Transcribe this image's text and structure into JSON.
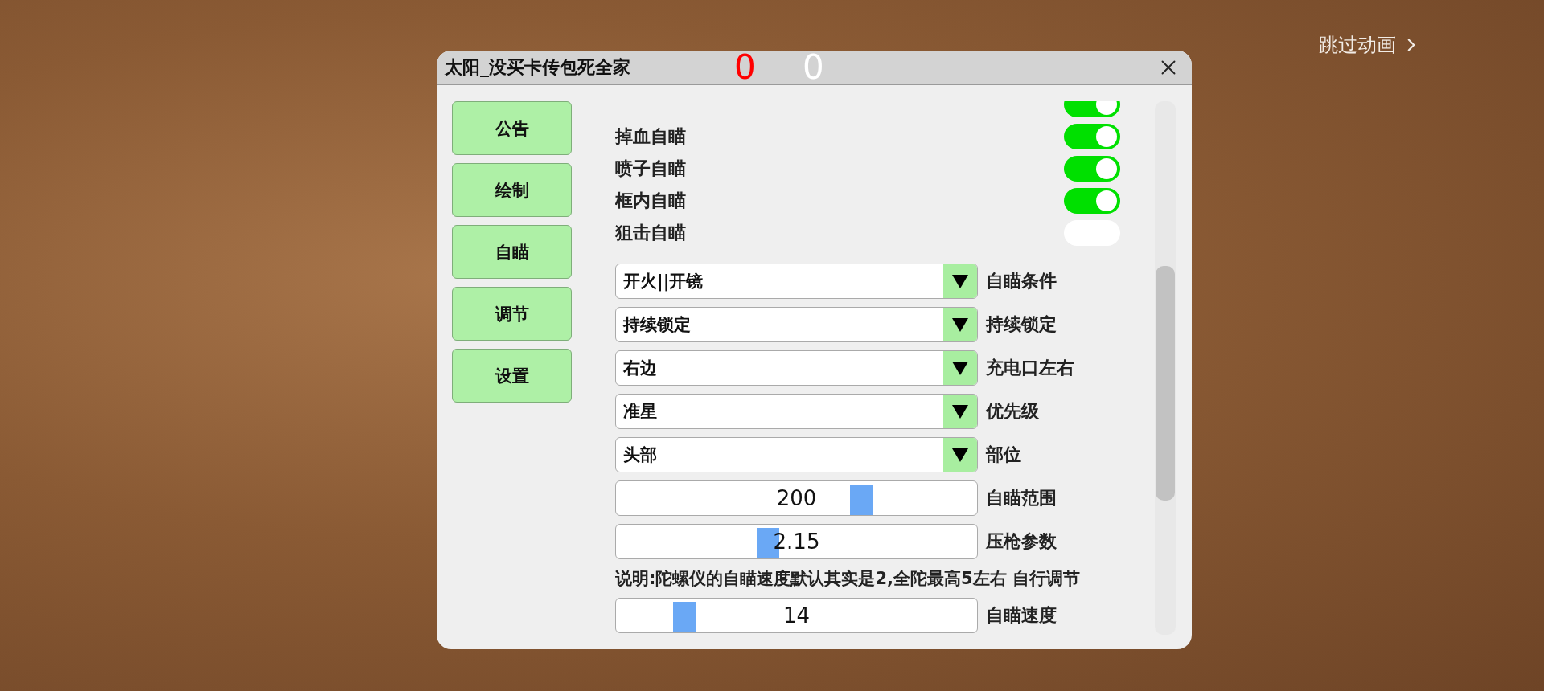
{
  "skip": {
    "label": "跳过动画"
  },
  "window": {
    "title": "太阳_没买卡传包死全家",
    "scores": [
      {
        "value": "0",
        "color": "#ff0000"
      },
      {
        "value": "0",
        "color": "#ffffff"
      }
    ]
  },
  "nav": [
    {
      "label": "公告"
    },
    {
      "label": "绘制"
    },
    {
      "label": "自瞄"
    },
    {
      "label": "调节"
    },
    {
      "label": "设置"
    }
  ],
  "toggles": [
    {
      "on": true
    },
    {
      "label": "掉血自瞄",
      "on": true
    },
    {
      "label": "喷子自瞄",
      "on": true
    },
    {
      "label": "框内自瞄",
      "on": true
    },
    {
      "label": "狙击自瞄",
      "on": false
    }
  ],
  "controls": [
    {
      "kind": "dropdown",
      "value": "开火||开镜",
      "label": "自瞄条件"
    },
    {
      "kind": "dropdown",
      "value": "持续锁定",
      "label": "持续锁定"
    },
    {
      "kind": "dropdown",
      "value": "右边",
      "label": "充电口左右"
    },
    {
      "kind": "dropdown",
      "value": "准星",
      "label": "优先级"
    },
    {
      "kind": "dropdown",
      "value": "头部",
      "label": "部位"
    },
    {
      "kind": "slider",
      "value": "200",
      "level": 0.68,
      "label": "自瞄范围"
    },
    {
      "kind": "slider",
      "value": "2.15",
      "level": 0.42,
      "label": "压枪参数"
    },
    {
      "kind": "note",
      "text": "说明:陀螺仪的自瞄速度默认其实是2,全陀最高5左右 自行调节"
    },
    {
      "kind": "slider",
      "value": "14",
      "level": 0.19,
      "label": "自瞄速度"
    }
  ]
}
